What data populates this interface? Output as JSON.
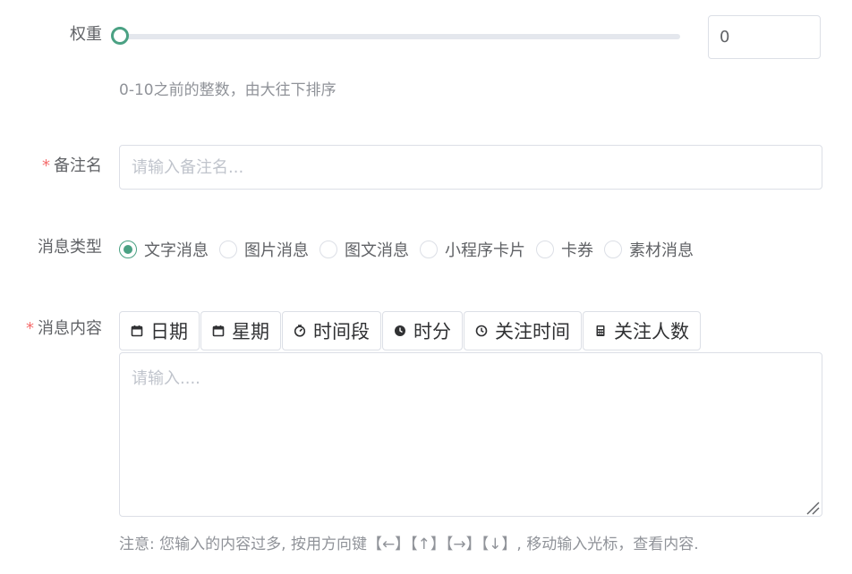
{
  "weight": {
    "label": "权重",
    "slider_value_fraction": 0,
    "value": "0",
    "tip": "0-10之前的整数，由大往下排序"
  },
  "remark": {
    "required_mark": "*",
    "label": "备注名",
    "placeholder": "请输入备注名..."
  },
  "message_type": {
    "label": "消息类型",
    "selected": "文字消息",
    "options": [
      "文字消息",
      "图片消息",
      "图文消息",
      "小程序卡片",
      "卡券",
      "素材消息"
    ]
  },
  "message_content": {
    "required_mark": "*",
    "label": "消息内容",
    "toolbar": [
      {
        "label": "日期",
        "icon": "calendar-icon"
      },
      {
        "label": "星期",
        "icon": "calendar-icon"
      },
      {
        "label": "时间段",
        "icon": "timer-icon"
      },
      {
        "label": "时分",
        "icon": "clock-filled-icon"
      },
      {
        "label": "关注时间",
        "icon": "clock-icon"
      },
      {
        "label": "关注人数",
        "icon": "calculator-icon"
      }
    ],
    "placeholder": "请输入....",
    "tip": "注意: 您输入的内容过多, 按用方向键【←】【↑】【→】【↓】, 移动输入光标，查看内容."
  },
  "colors": {
    "accent": "#4aa183",
    "required": "#f56c6c",
    "border": "#dcdfe6",
    "text": "#606266",
    "muted": "#909399",
    "placeholder": "#c0c4cc"
  }
}
